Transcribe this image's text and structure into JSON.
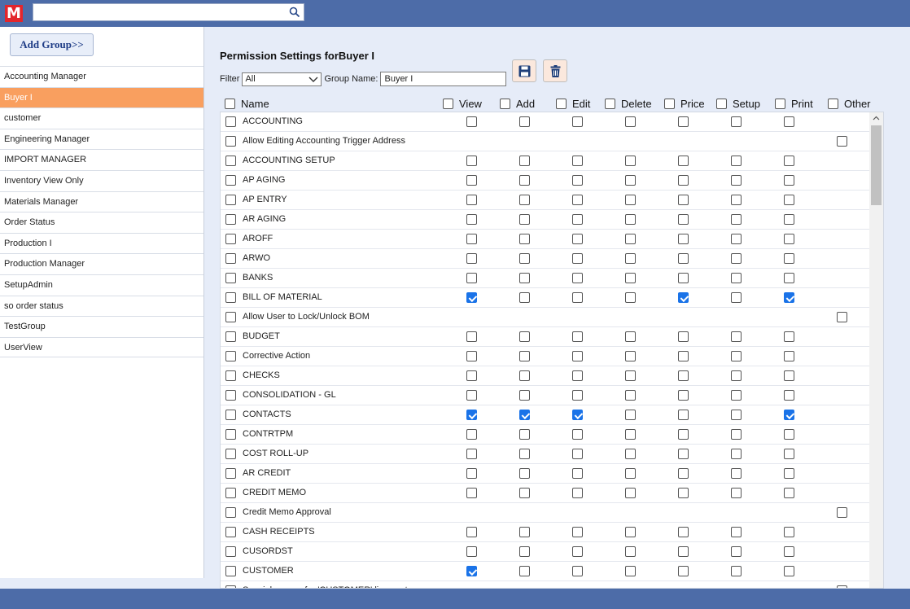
{
  "app": {
    "logo_letter": "M",
    "search_value": ""
  },
  "sidebar": {
    "add_group_label": "Add Group>>",
    "groups": [
      {
        "label": "Accounting Manager",
        "active": false
      },
      {
        "label": "Buyer I",
        "active": true
      },
      {
        "label": "customer",
        "active": false
      },
      {
        "label": "Engineering Manager",
        "active": false
      },
      {
        "label": "IMPORT MANAGER",
        "active": false
      },
      {
        "label": "Inventory View Only",
        "active": false
      },
      {
        "label": "Materials Manager",
        "active": false
      },
      {
        "label": "Order Status",
        "active": false
      },
      {
        "label": "Production I",
        "active": false
      },
      {
        "label": "Production Manager",
        "active": false
      },
      {
        "label": "SetupAdmin",
        "active": false
      },
      {
        "label": "so order status",
        "active": false
      },
      {
        "label": "TestGroup",
        "active": false
      },
      {
        "label": "UserView",
        "active": false
      }
    ]
  },
  "main": {
    "title": "Permission Settings forBuyer I",
    "filter_label": "Filter",
    "filter_value": "All",
    "group_name_label": "Group Name:",
    "group_name_value": "Buyer I",
    "columns": [
      "Name",
      "View",
      "Add",
      "Edit",
      "Delete",
      "Price",
      "Setup",
      "Print",
      "Other"
    ],
    "rows": [
      {
        "name": "ACCOUNTING",
        "type": "std",
        "checks": [
          0,
          0,
          0,
          0,
          0,
          0,
          0
        ]
      },
      {
        "name": "Allow Editing Accounting Trigger Address",
        "type": "other",
        "other": 0
      },
      {
        "name": "ACCOUNTING SETUP",
        "type": "std",
        "checks": [
          0,
          0,
          0,
          0,
          0,
          0,
          0
        ]
      },
      {
        "name": "AP AGING",
        "type": "std",
        "checks": [
          0,
          0,
          0,
          0,
          0,
          0,
          0
        ]
      },
      {
        "name": "AP ENTRY",
        "type": "std",
        "checks": [
          0,
          0,
          0,
          0,
          0,
          0,
          0
        ]
      },
      {
        "name": "AR AGING",
        "type": "std",
        "checks": [
          0,
          0,
          0,
          0,
          0,
          0,
          0
        ]
      },
      {
        "name": "AROFF",
        "type": "std",
        "checks": [
          0,
          0,
          0,
          0,
          0,
          0,
          0
        ]
      },
      {
        "name": "ARWO",
        "type": "std",
        "checks": [
          0,
          0,
          0,
          0,
          0,
          0,
          0
        ]
      },
      {
        "name": "BANKS",
        "type": "std",
        "checks": [
          0,
          0,
          0,
          0,
          0,
          0,
          0
        ]
      },
      {
        "name": "BILL OF MATERIAL",
        "type": "std",
        "checks": [
          1,
          0,
          0,
          0,
          1,
          0,
          1
        ]
      },
      {
        "name": "Allow User to Lock/Unlock BOM",
        "type": "other",
        "other": 0
      },
      {
        "name": "BUDGET",
        "type": "std",
        "checks": [
          0,
          0,
          0,
          0,
          0,
          0,
          0
        ]
      },
      {
        "name": "Corrective Action",
        "type": "std",
        "checks": [
          0,
          0,
          0,
          0,
          0,
          0,
          0
        ]
      },
      {
        "name": "CHECKS",
        "type": "std",
        "checks": [
          0,
          0,
          0,
          0,
          0,
          0,
          0
        ]
      },
      {
        "name": "CONSOLIDATION - GL",
        "type": "std",
        "checks": [
          0,
          0,
          0,
          0,
          0,
          0,
          0
        ]
      },
      {
        "name": "CONTACTS",
        "type": "std",
        "checks": [
          1,
          1,
          1,
          0,
          0,
          0,
          1
        ]
      },
      {
        "name": "CONTRTPM",
        "type": "std",
        "checks": [
          0,
          0,
          0,
          0,
          0,
          0,
          0
        ]
      },
      {
        "name": "COST ROLL-UP",
        "type": "std",
        "checks": [
          0,
          0,
          0,
          0,
          0,
          0,
          0
        ]
      },
      {
        "name": "AR CREDIT",
        "type": "std",
        "checks": [
          0,
          0,
          0,
          0,
          0,
          0,
          0
        ]
      },
      {
        "name": "CREDIT MEMO",
        "type": "std",
        "checks": [
          0,
          0,
          0,
          0,
          0,
          0,
          0
        ]
      },
      {
        "name": "Credit Memo Approval",
        "type": "other",
        "other": 0
      },
      {
        "name": "CASH RECEIPTS",
        "type": "std",
        "checks": [
          0,
          0,
          0,
          0,
          0,
          0,
          0
        ]
      },
      {
        "name": "CUSORDST",
        "type": "std",
        "checks": [
          0,
          0,
          0,
          0,
          0,
          0,
          0
        ]
      },
      {
        "name": "CUSTOMER",
        "type": "std",
        "checks": [
          1,
          0,
          0,
          0,
          0,
          0,
          0
        ]
      },
      {
        "name": "Special access for 'CUSTOMER' license type",
        "type": "other",
        "other": 0
      }
    ]
  },
  "colors": {
    "topbar": "#4d6ca8",
    "active_item": "#f99f5f",
    "checked": "#1a73e8"
  },
  "icons": {
    "search": "search-icon",
    "save": "floppy-disk-icon",
    "delete": "trash-icon"
  }
}
